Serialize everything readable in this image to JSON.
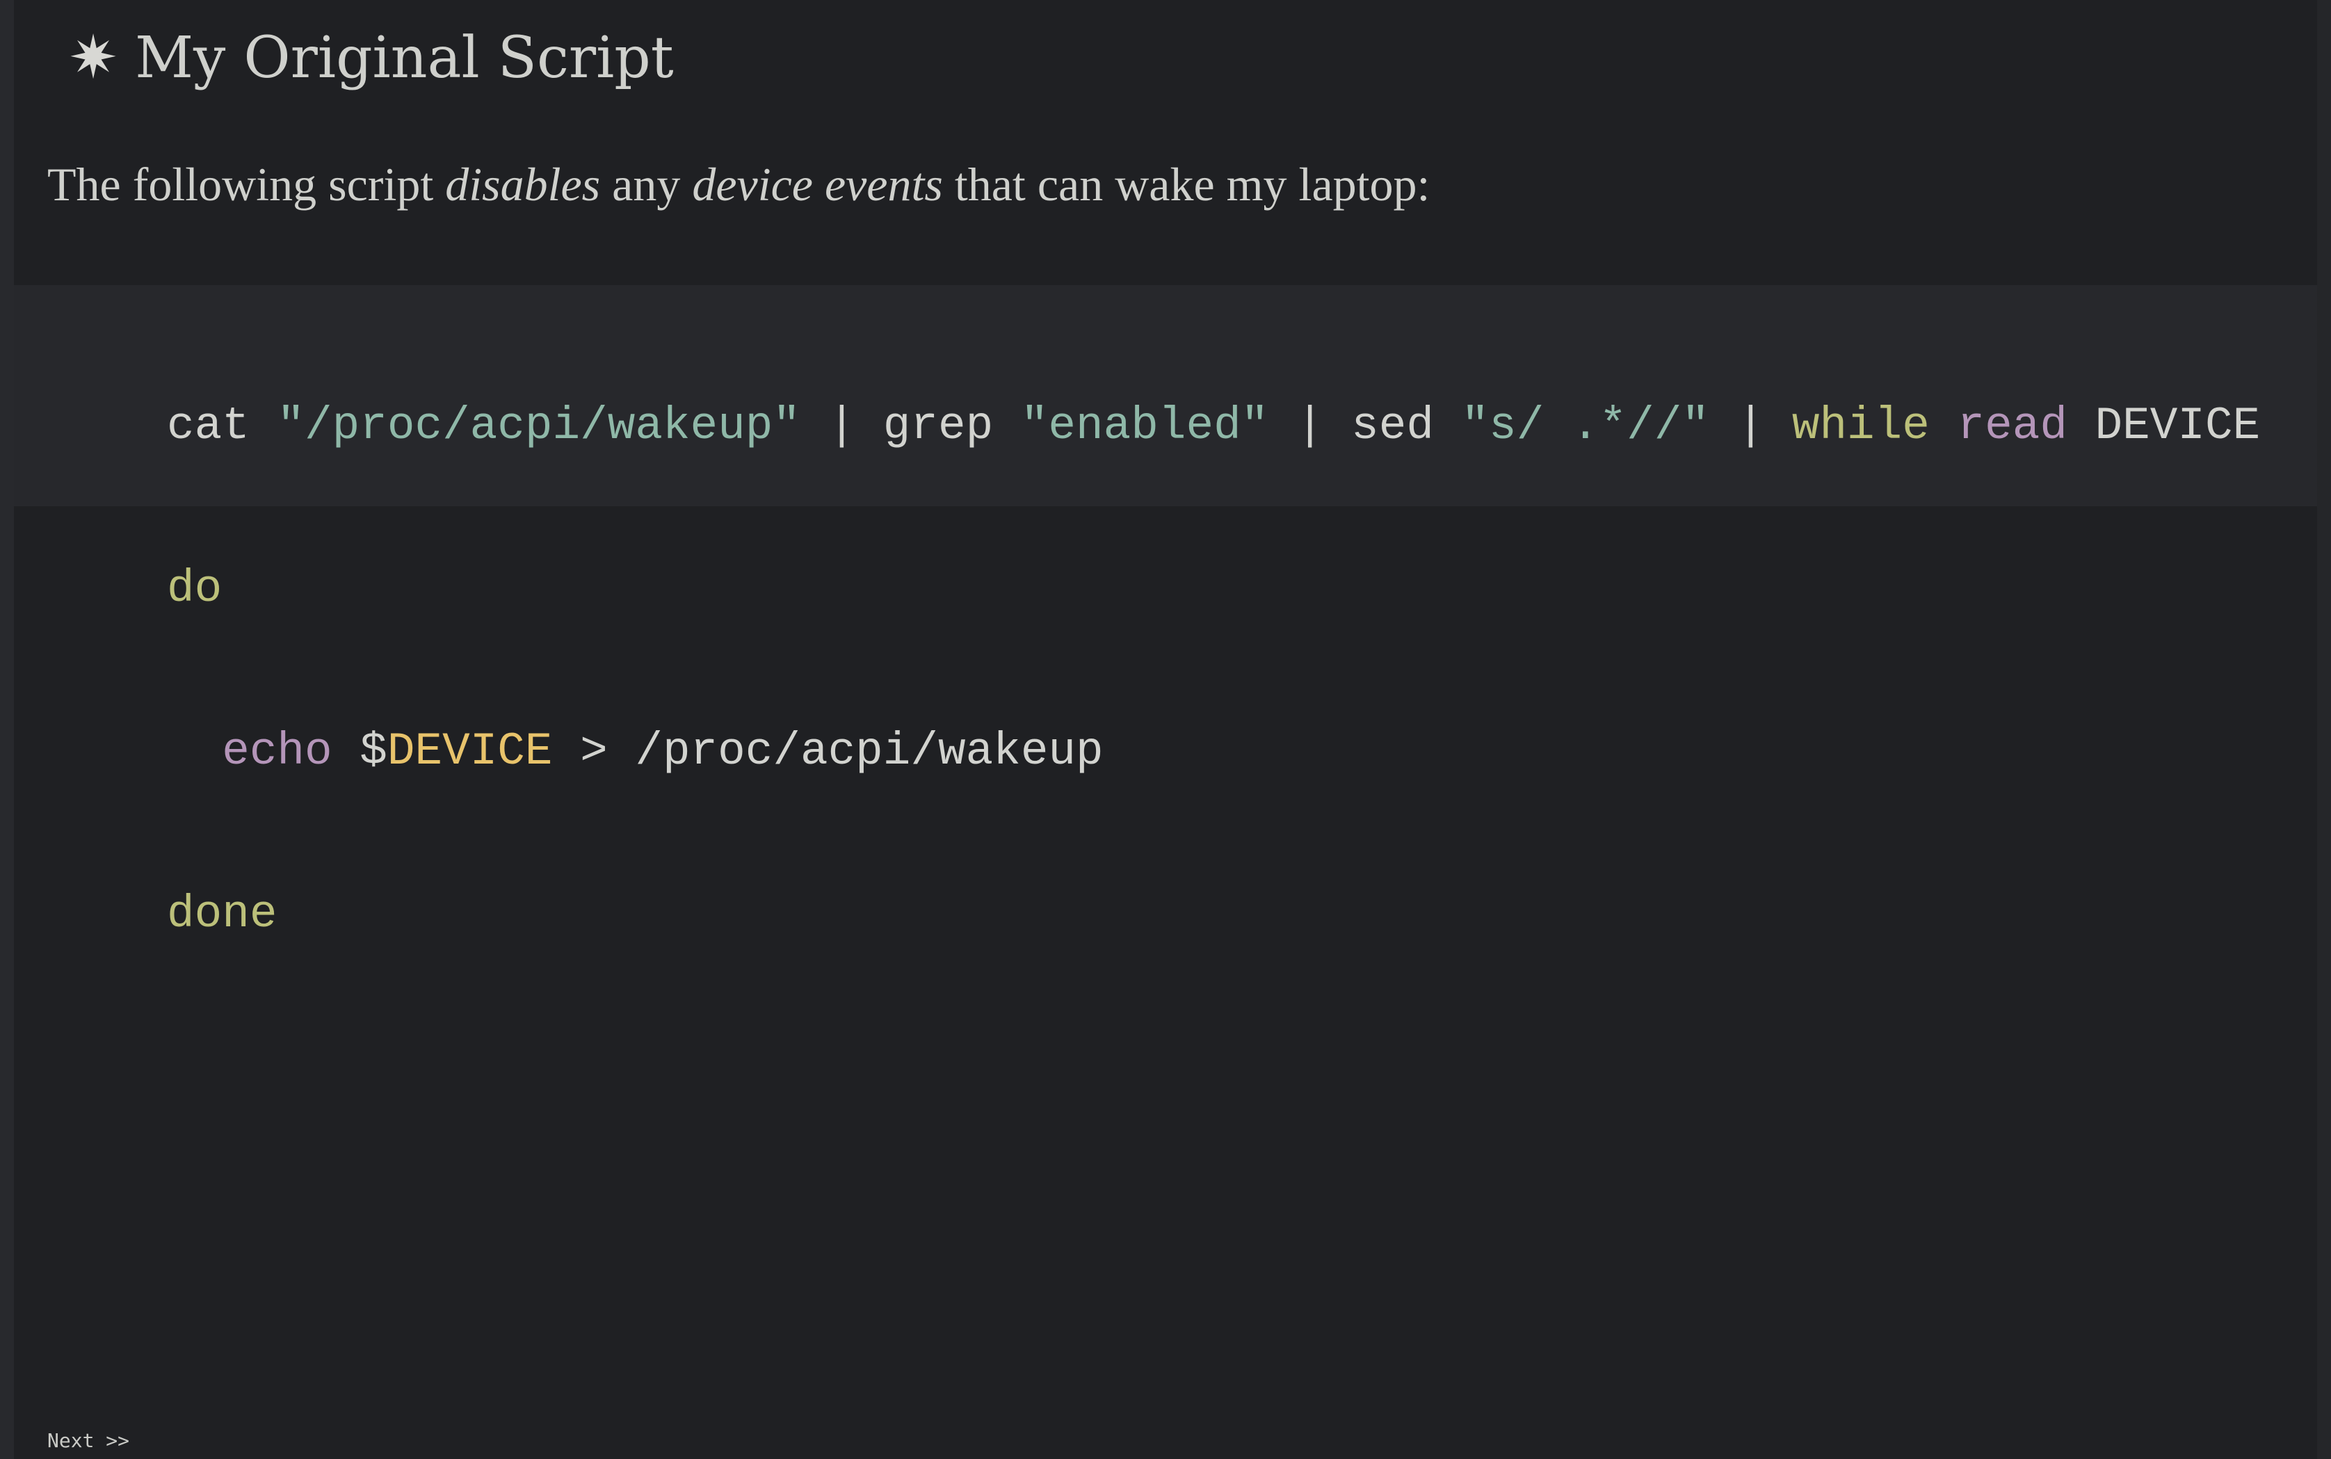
{
  "page": {
    "heading": {
      "icon": "asterisk-icon",
      "icon_glyph": "✷",
      "title": "My Original Script"
    },
    "intro": {
      "part1": "The following script ",
      "em1": "disables",
      "part2": " any ",
      "em2": "device events",
      "part3": " that can wake my laptop:"
    },
    "code": {
      "line1": {
        "cmd_cat": "cat ",
        "str_path": "\"/proc/acpi/wakeup\"",
        "pipe1": " | grep ",
        "str_enabled": "\"enabled\"",
        "pipe2": " | sed ",
        "str_sed": "\"s/ .*//\"",
        "pipe3": " | ",
        "kw_while": "while",
        "space1": " ",
        "bi_read": "read",
        "var_device": " DEVICE"
      },
      "line2": {
        "kw_do": "do"
      },
      "line3": {
        "indent": "  ",
        "bi_echo": "echo",
        "dollar": " $",
        "var_device": "DEVICE",
        "rest": " > /proc/acpi/wakeup"
      },
      "line4": {
        "kw_done": "done"
      }
    },
    "footer": {
      "next_label": "Next >>"
    }
  },
  "colors": {
    "background": "#1f2023",
    "code_background": "#27282c",
    "text": "#cfd0cc",
    "string": "#8fb8a8",
    "keyword": "#bcc07a",
    "builtin": "#b495b9",
    "variable": "#e8c36b"
  }
}
